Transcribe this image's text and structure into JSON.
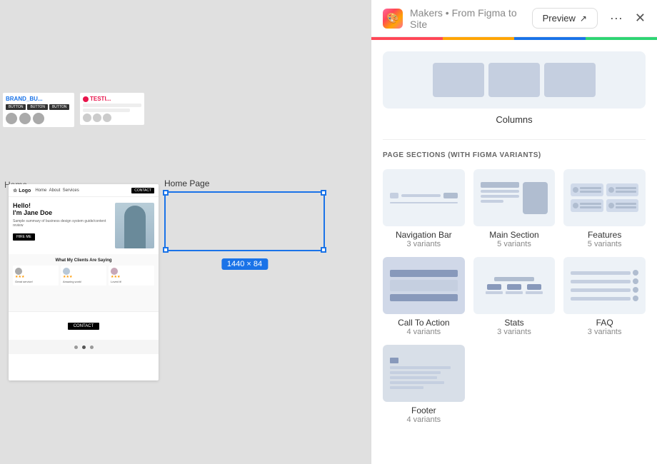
{
  "app": {
    "title": "Makers",
    "subtitle": "From Figma to Site",
    "preview_label": "Preview",
    "more_label": "•••"
  },
  "progress": {
    "colors": [
      "#ff4757",
      "#ffa502",
      "#1a73e8",
      "#2ed573"
    ]
  },
  "canvas": {
    "home_label": "Home",
    "homepage_label": "Home Page",
    "dimension": "1440 × 84"
  },
  "panel": {
    "columns_label": "Columns",
    "sections_heading": "PAGE SECTIONS (WITH FIGMA VARIANTS)",
    "sections": [
      {
        "name": "Navigation Bar",
        "variants": "3 variants",
        "type": "navbar"
      },
      {
        "name": "Main Section",
        "variants": "5 variants",
        "type": "main"
      },
      {
        "name": "Features",
        "variants": "5 variants",
        "type": "features"
      },
      {
        "name": "Call To Action",
        "variants": "4 variants",
        "type": "cta"
      },
      {
        "name": "Stats",
        "variants": "3 variants",
        "type": "stats"
      },
      {
        "name": "FAQ",
        "variants": "3 variants",
        "type": "faq"
      },
      {
        "name": "Footer",
        "variants": "4 variants",
        "type": "footer"
      }
    ]
  }
}
